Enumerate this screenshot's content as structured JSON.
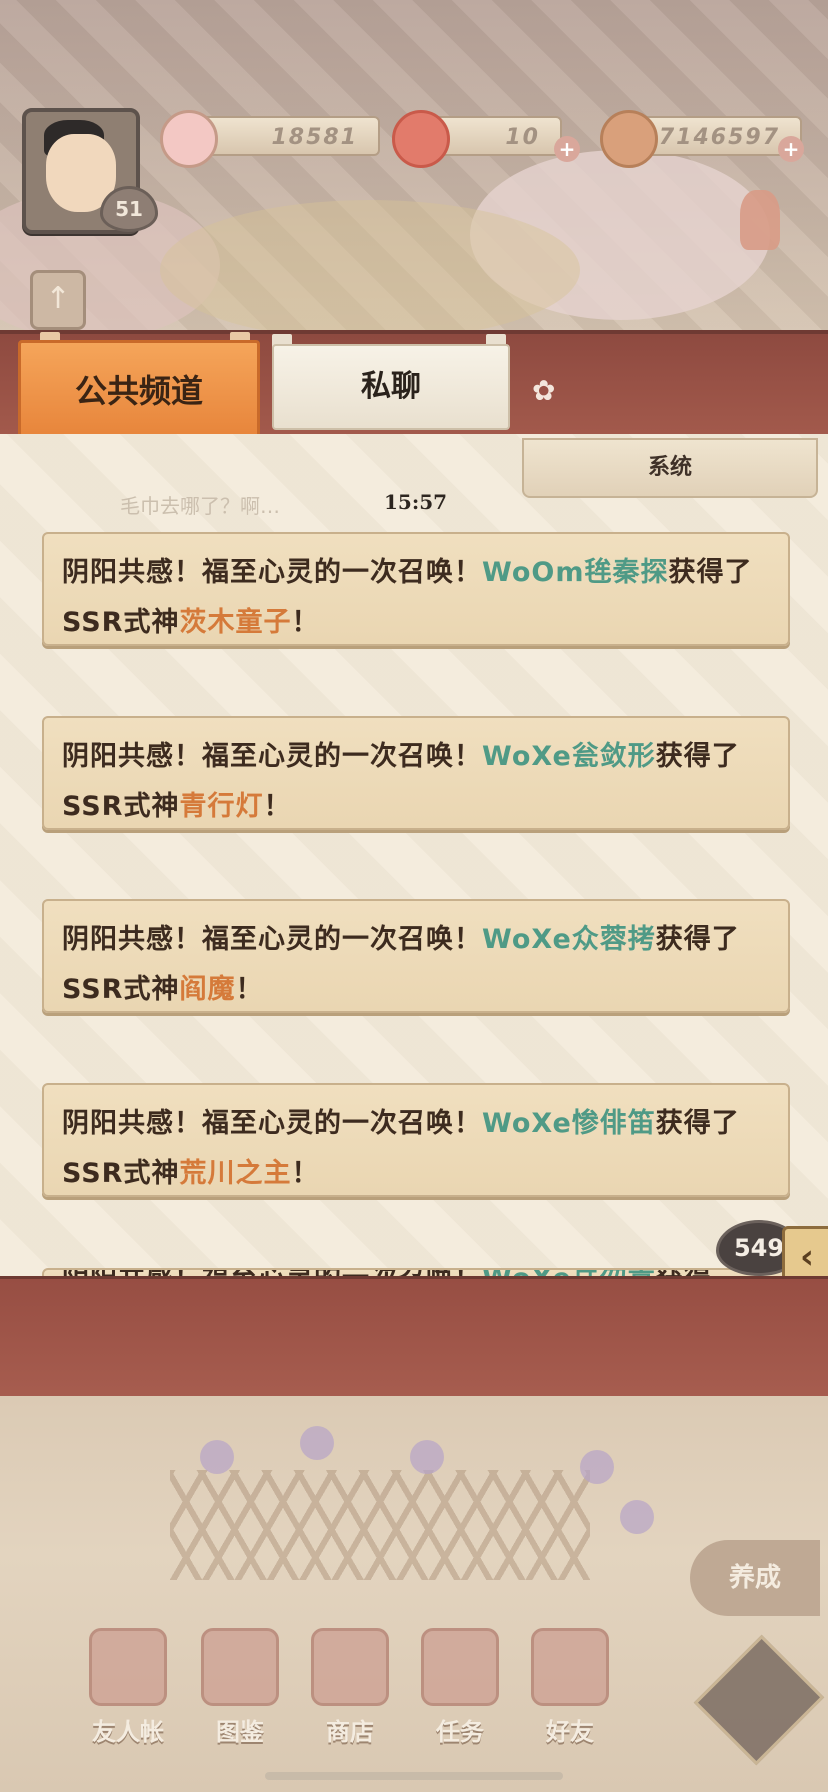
{
  "header": {
    "level": "51",
    "resources": [
      {
        "name": "sakura",
        "value": "18581"
      },
      {
        "name": "jade",
        "value": "10"
      },
      {
        "name": "coin",
        "value": "7146597"
      }
    ]
  },
  "tabs": {
    "public": "公共频道",
    "private": "私聊",
    "system": "系统"
  },
  "chat": {
    "ghost_message": "毛巾去哪了？啊…",
    "timestamp": "15:57",
    "messages": [
      {
        "prefix": "阴阳共感！福至心灵的一次召唤！",
        "name": "WoOm毪秦探",
        "mid": "获得了SSR式神",
        "god": "茨木童子",
        "suffix": "！"
      },
      {
        "prefix": "阴阳共感！福至心灵的一次召唤！",
        "name": "WoXe瓮敛形",
        "mid": "获得了SSR式神",
        "god": "青行灯",
        "suffix": "！"
      },
      {
        "prefix": "阴阳共感！福至心灵的一次召唤！",
        "name": "WoXe众蓉拷",
        "mid": "获得了SSR式神",
        "god": "阎魔",
        "suffix": "！"
      },
      {
        "prefix": "阴阳共感！福至心灵的一次召唤！",
        "name": "WoXe惨俳笛",
        "mid": "获得了SSR式神",
        "god": "荒川之主",
        "suffix": "！"
      },
      {
        "prefix": "阴阳共感！福至心灵的一次召唤！",
        "name": "WoXe岳勿嵩",
        "mid": "获得",
        "god": "",
        "suffix": ""
      }
    ],
    "unread_count": "549"
  },
  "bottom_nav": {
    "nurture": "养成",
    "items": [
      {
        "label": "友人帐",
        "icon": "friend-book-icon"
      },
      {
        "label": "图鉴",
        "icon": "illustrated-book-icon"
      },
      {
        "label": "商店",
        "icon": "shop-icon"
      },
      {
        "label": "任务",
        "icon": "task-icon"
      },
      {
        "label": "好友",
        "icon": "friends-icon"
      }
    ]
  },
  "colors": {
    "player_name": "#4f9a86",
    "shikigami_name": "#d57a3a",
    "tab_active": "#e7843a"
  }
}
